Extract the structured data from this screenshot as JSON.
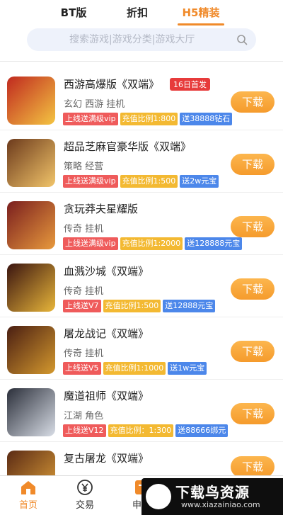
{
  "tabs": [
    {
      "label": "BT版"
    },
    {
      "label": "折扣"
    },
    {
      "label": "H5精装"
    }
  ],
  "search": {
    "placeholder": "搜索游戏|游戏分类|游戏大厅"
  },
  "games": [
    {
      "name": "西游高爆版《双端》",
      "badge": "16日首发",
      "tags": "玄幻 西游 挂机",
      "perks": [
        "上线送满级vip",
        "充值比例1:800",
        "送38888钻石"
      ],
      "icon_colors": [
        "#c0291f",
        "#f4c542"
      ]
    },
    {
      "name": "超品芝麻官豪华版《双端》",
      "badge": "",
      "tags": "策略 经营",
      "perks": [
        "上线送满级vip",
        "充值比例1:500",
        "送2w元宝"
      ],
      "icon_colors": [
        "#6c3a1c",
        "#f2c56a"
      ]
    },
    {
      "name": "贪玩莽夫星耀版",
      "badge": "",
      "tags": "传奇 挂机",
      "perks": [
        "上线送满级vip",
        "充值比例1:2000",
        "送128888元宝"
      ],
      "icon_colors": [
        "#7a1e1e",
        "#e89a3d"
      ]
    },
    {
      "name": "血溅沙城《双端》",
      "badge": "",
      "tags": "传奇 挂机",
      "perks": [
        "上线送V7",
        "充值比例1:500",
        "送12888元宝"
      ],
      "icon_colors": [
        "#3a1410",
        "#e8b63a"
      ]
    },
    {
      "name": "屠龙战记《双端》",
      "badge": "",
      "tags": "传奇 挂机",
      "perks": [
        "上线送V5",
        "充值比例1:1000",
        "送1w元宝"
      ],
      "icon_colors": [
        "#4a1e12",
        "#d4992e"
      ]
    },
    {
      "name": "魔道祖师《双端》",
      "badge": "",
      "tags": "江湖 角色",
      "perks": [
        "上线送V12",
        "充值比例：1:300",
        "送88666绑元"
      ],
      "icon_colors": [
        "#2b2f3a",
        "#d8dde6"
      ]
    },
    {
      "name": "复古屠龙《双端》",
      "badge": "",
      "tags": "",
      "perks": [],
      "icon_colors": [
        "#5a2a14",
        "#e0a13a"
      ]
    }
  ],
  "download_label": "下载",
  "bottom_nav": [
    {
      "label": "首页",
      "icon": "home-icon"
    },
    {
      "label": "交易",
      "icon": "yen-icon"
    },
    {
      "label": "申请",
      "icon": "apply-icon"
    }
  ],
  "watermark": {
    "title": "下载鸟资源",
    "url": "www.xiazainiao.com"
  },
  "colors": {
    "accent": "#f08a2a",
    "red_tag": "#ef5b5b",
    "yellow_tag": "#f3b932",
    "blue_tag": "#4c87ea",
    "badge": "#e73b3b"
  }
}
